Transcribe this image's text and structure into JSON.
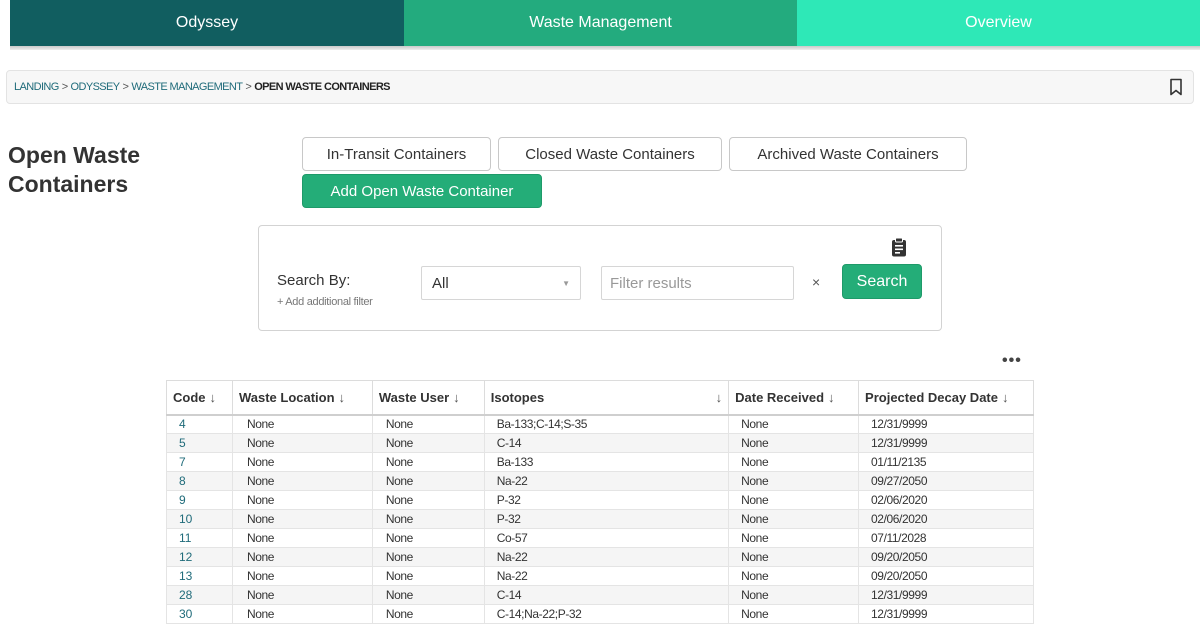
{
  "nav": {
    "tabs": [
      "Odyssey",
      "Waste Management",
      "Overview"
    ],
    "colors": [
      "#115e60",
      "#23ab7e",
      "#2ee8b7"
    ]
  },
  "breadcrumb": {
    "items": [
      "LANDING",
      "ODYSSEY",
      "WASTE MANAGEMENT"
    ],
    "separator": ">",
    "current": "OPEN WASTE CONTAINERS",
    "bookmark_icon": "bookmark-icon"
  },
  "page": {
    "title": "Open Waste Containers"
  },
  "actions": {
    "in_transit": "In-Transit Containers",
    "closed": "Closed Waste Containers",
    "archived": "Archived Waste Containers",
    "add": "Add Open Waste Container"
  },
  "search": {
    "label": "Search By:",
    "add_filter": "+ Add additional filter",
    "select_value": "All",
    "placeholder": "Filter results",
    "clear": "×",
    "button": "Search",
    "clipboard_icon": "clipboard-icon"
  },
  "table": {
    "more": "•••",
    "sort_arrow": "↓",
    "headers": [
      "Code",
      "Waste Location",
      "Waste User",
      "Isotopes",
      "Date Received",
      "Projected Decay Date"
    ],
    "rows": [
      [
        "4",
        "None",
        "None",
        "Ba-133;C-14;S-35",
        "None",
        "12/31/9999"
      ],
      [
        "5",
        "None",
        "None",
        "C-14",
        "None",
        "12/31/9999"
      ],
      [
        "7",
        "None",
        "None",
        "Ba-133",
        "None",
        "01/11/2135"
      ],
      [
        "8",
        "None",
        "None",
        "Na-22",
        "None",
        "09/27/2050"
      ],
      [
        "9",
        "None",
        "None",
        "P-32",
        "None",
        "02/06/2020"
      ],
      [
        "10",
        "None",
        "None",
        "P-32",
        "None",
        "02/06/2020"
      ],
      [
        "11",
        "None",
        "None",
        "Co-57",
        "None",
        "07/11/2028"
      ],
      [
        "12",
        "None",
        "None",
        "Na-22",
        "None",
        "09/20/2050"
      ],
      [
        "13",
        "None",
        "None",
        "Na-22",
        "None",
        "09/20/2050"
      ],
      [
        "28",
        "None",
        "None",
        "C-14",
        "None",
        "12/31/9999"
      ],
      [
        "30",
        "None",
        "None",
        "C-14;Na-22;P-32",
        "None",
        "12/31/9999"
      ]
    ]
  },
  "colors": {
    "accent": "#24ad78",
    "link": "#1f6b7a"
  }
}
